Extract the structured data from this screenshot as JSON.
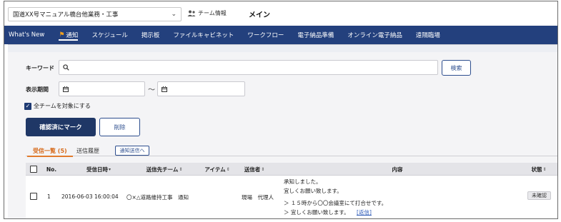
{
  "header": {
    "project_select": "国道XX号マニュアル橋台他業務・工事",
    "team_info": "チーム情報",
    "title": "メイン"
  },
  "nav": {
    "items": [
      {
        "label": "What's New"
      },
      {
        "label": "通知"
      },
      {
        "label": "スケジュール"
      },
      {
        "label": "掲示板"
      },
      {
        "label": "ファイルキャビネット"
      },
      {
        "label": "ワークフロー"
      },
      {
        "label": "電子納品準備"
      },
      {
        "label": "オンライン電子納品"
      },
      {
        "label": "遠隔臨場"
      }
    ],
    "active": "通知"
  },
  "search": {
    "keyword_label": "キーワード",
    "keyword_value": "",
    "search_button": "検索",
    "period_label": "表示期間",
    "period_separator": "～",
    "all_teams_label": "全チームを対象にする",
    "all_teams_checked": true
  },
  "actions": {
    "mark_confirmed": "確認済にマーク",
    "delete": "削除"
  },
  "tabs": {
    "received": "受信一覧 (5)",
    "sent_history": "送信履歴",
    "send_notice_button": "通知送信へ"
  },
  "table": {
    "columns": {
      "no": "No.",
      "received_at": "受信日時",
      "destination_team": "送信先チーム",
      "item": "アイテム",
      "sender": "送信者",
      "content": "内容",
      "status": "状態"
    },
    "rows": [
      {
        "no": "1",
        "received_at": "2016-06-03 16:00:04",
        "destination_team": "〇×△道路維持工事　通知",
        "item": "",
        "sender": "現場　代理人",
        "content_line1": "承知しました。",
        "content_line2": "宜しくお願い致します。",
        "content_line3": "＞ １５時から〇〇会議室にて打合せです。",
        "content_line4": "＞ 宜しくお願い致します。",
        "content_link": "[返信]",
        "status": "未確認"
      }
    ]
  },
  "colors": {
    "nav_bg": "#23407d",
    "primary_button": "#1f3766",
    "active_tab": "#d76b1c",
    "link": "#2f5cb8",
    "flag": "#f0a020"
  }
}
